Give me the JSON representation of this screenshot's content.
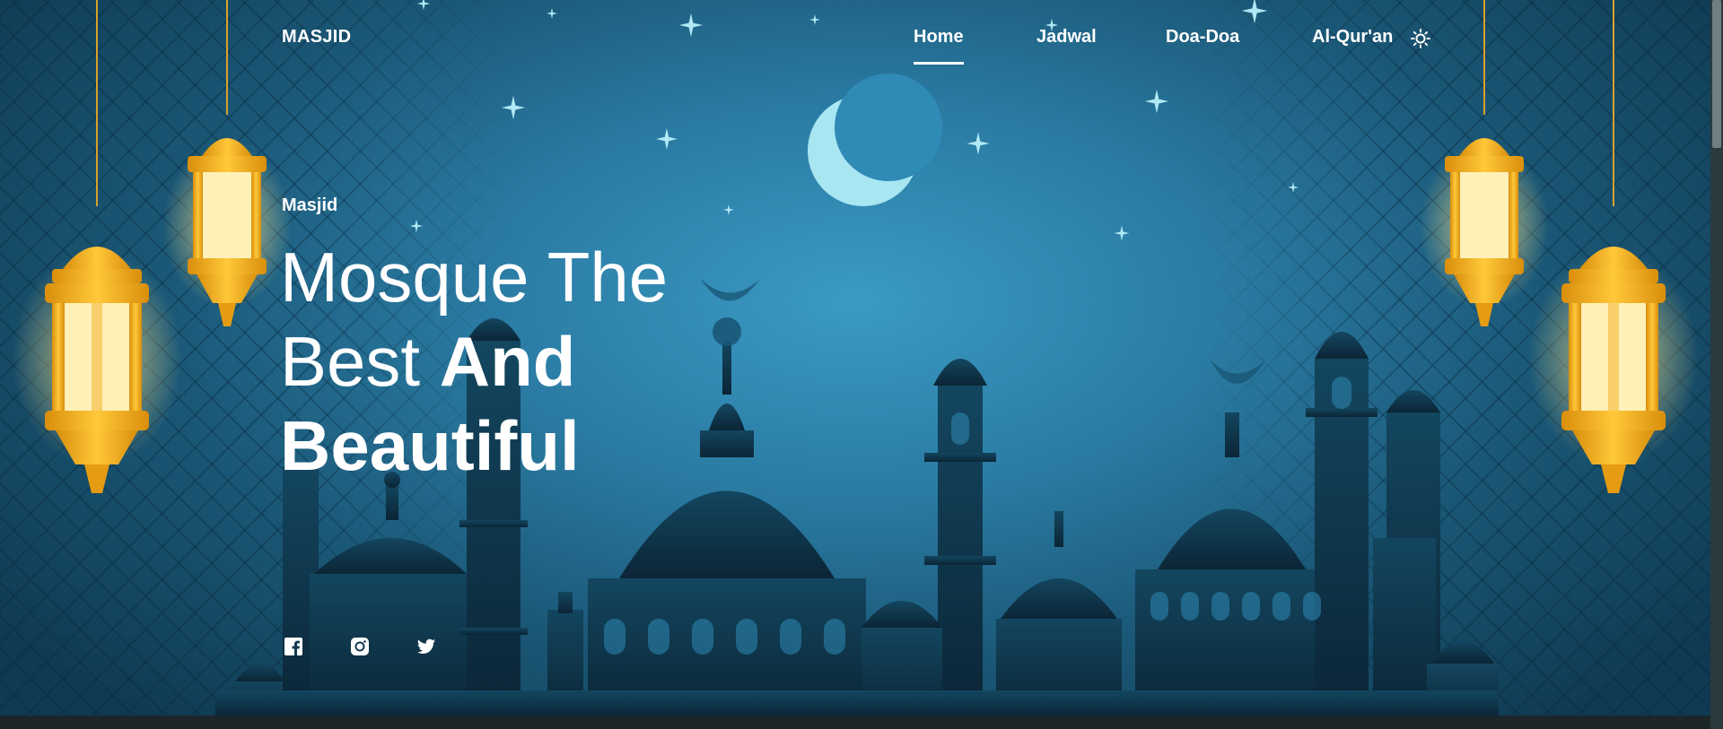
{
  "brand": {
    "name": "MASJID"
  },
  "nav": {
    "items": [
      {
        "label": "Home",
        "active": true
      },
      {
        "label": "Jadwal",
        "active": false
      },
      {
        "label": "Doa-Doa",
        "active": false
      },
      {
        "label": "Al-Qur'an",
        "active": false
      }
    ],
    "theme_toggle_icon": "sun-icon"
  },
  "hero": {
    "eyebrow": "Masjid",
    "headline_line1": "Mosque The",
    "headline_line2_regular": "Best ",
    "headline_line2_bold": "And",
    "headline_line3_bold": "Beautiful"
  },
  "social": {
    "icons": [
      "facebook-icon",
      "instagram-icon",
      "twitter-icon"
    ]
  },
  "colors": {
    "sky_center": "#3b9ac4",
    "sky_edge": "#0f3a52",
    "silhouette": "#0e3247",
    "lantern_gold": "#f2b320",
    "lantern_glow": "#fff3c4",
    "moon": "#a8e6f2",
    "text": "#ffffff"
  }
}
